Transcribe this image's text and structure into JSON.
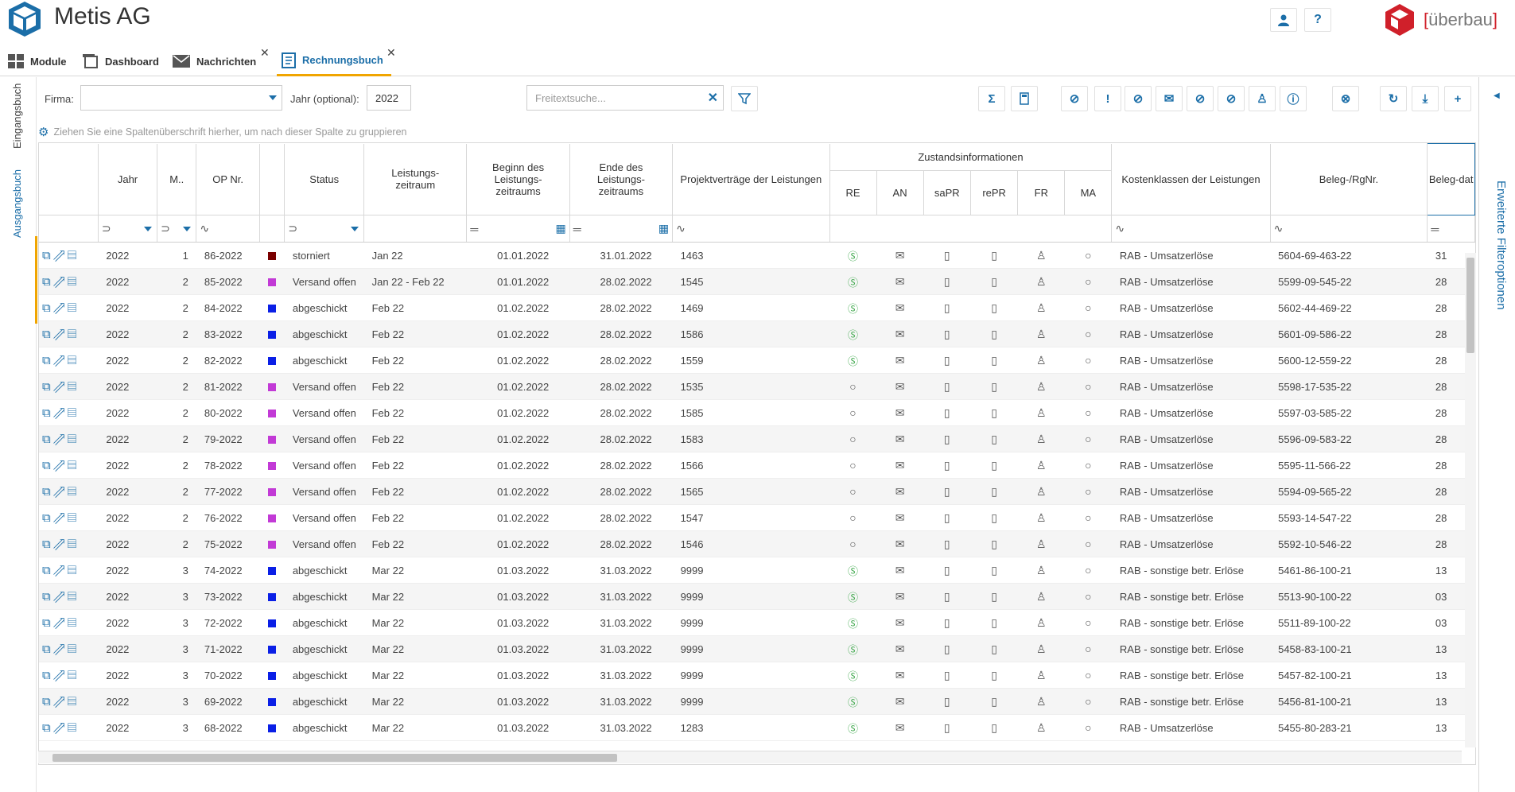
{
  "app": {
    "title": "Metis AG",
    "brand": "überbau"
  },
  "header_buttons": {
    "user": "user-icon",
    "help": "?"
  },
  "tabs": [
    {
      "label": "Module"
    },
    {
      "label": "Dashboard"
    },
    {
      "label": "Nachrichten"
    },
    {
      "label": "Rechnungsbuch"
    }
  ],
  "side_tabs": {
    "eingang": "Eingangsbuch",
    "ausgang": "Ausgangsbuch"
  },
  "filters": {
    "firma_label": "Firma:",
    "firma_value": "",
    "jahr_label": "Jahr (optional):",
    "jahr_value": "2022",
    "search_placeholder": "Freitextsuche..."
  },
  "group_hint": "Ziehen Sie eine Spaltenüberschrift hierher, um nach dieser Spalte zu gruppieren",
  "right_panel": {
    "label": "Erweiterte Filteroptionen"
  },
  "columns": {
    "jahr": "Jahr",
    "monat": "M..",
    "op": "OP Nr.",
    "status": "Status",
    "leistung": "Leistungs-zeitraum",
    "beginn": "Beginn des Leistungs-zeitraums",
    "ende": "Ende des Leistungs-zeitraums",
    "projekt": "Projektverträge der Leistungen",
    "zustand": "Zustandsinformationen",
    "re": "RE",
    "an": "AN",
    "sapr": "saPR",
    "repr": "rePR",
    "fr": "FR",
    "ma": "MA",
    "kosten": "Kostenklassen der Leistungen",
    "beleg": "Beleg-/RgNr.",
    "belegdat": "Beleg-dat"
  },
  "status_colors": {
    "storniert": "#7a0000",
    "Versand offen": "#c23ad6",
    "abgeschickt": "#0a1fe6"
  },
  "rows": [
    {
      "jahr": "2022",
      "m": "1",
      "op": "86-2022",
      "status": "storniert",
      "color": "#7a0000",
      "lz": "Jan 22",
      "beginn": "01.01.2022",
      "ende": "31.01.2022",
      "projekt": "1463",
      "re": "paid",
      "kosten": "RAB - Umsatzerlöse",
      "beleg": "5604-69-463-22",
      "bd": "31"
    },
    {
      "jahr": "2022",
      "m": "2",
      "op": "85-2022",
      "status": "Versand offen",
      "color": "#c23ad6",
      "lz": "Jan 22 - Feb 22",
      "beginn": "01.01.2022",
      "ende": "28.02.2022",
      "projekt": "1545",
      "re": "paid",
      "kosten": "RAB - Umsatzerlöse",
      "beleg": "5599-09-545-22",
      "bd": "28"
    },
    {
      "jahr": "2022",
      "m": "2",
      "op": "84-2022",
      "status": "abgeschickt",
      "color": "#0a1fe6",
      "lz": "Feb 22",
      "beginn": "01.02.2022",
      "ende": "28.02.2022",
      "projekt": "1469",
      "re": "paid",
      "kosten": "RAB - Umsatzerlöse",
      "beleg": "5602-44-469-22",
      "bd": "28"
    },
    {
      "jahr": "2022",
      "m": "2",
      "op": "83-2022",
      "status": "abgeschickt",
      "color": "#0a1fe6",
      "lz": "Feb 22",
      "beginn": "01.02.2022",
      "ende": "28.02.2022",
      "projekt": "1586",
      "re": "paid",
      "kosten": "RAB - Umsatzerlöse",
      "beleg": "5601-09-586-22",
      "bd": "28"
    },
    {
      "jahr": "2022",
      "m": "2",
      "op": "82-2022",
      "status": "abgeschickt",
      "color": "#0a1fe6",
      "lz": "Feb 22",
      "beginn": "01.02.2022",
      "ende": "28.02.2022",
      "projekt": "1559",
      "re": "paid",
      "kosten": "RAB - Umsatzerlöse",
      "beleg": "5600-12-559-22",
      "bd": "28"
    },
    {
      "jahr": "2022",
      "m": "2",
      "op": "81-2022",
      "status": "Versand offen",
      "color": "#c23ad6",
      "lz": "Feb 22",
      "beginn": "01.02.2022",
      "ende": "28.02.2022",
      "projekt": "1535",
      "re": "open",
      "kosten": "RAB - Umsatzerlöse",
      "beleg": "5598-17-535-22",
      "bd": "28"
    },
    {
      "jahr": "2022",
      "m": "2",
      "op": "80-2022",
      "status": "Versand offen",
      "color": "#c23ad6",
      "lz": "Feb 22",
      "beginn": "01.02.2022",
      "ende": "28.02.2022",
      "projekt": "1585",
      "re": "open",
      "kosten": "RAB - Umsatzerlöse",
      "beleg": "5597-03-585-22",
      "bd": "28"
    },
    {
      "jahr": "2022",
      "m": "2",
      "op": "79-2022",
      "status": "Versand offen",
      "color": "#c23ad6",
      "lz": "Feb 22",
      "beginn": "01.02.2022",
      "ende": "28.02.2022",
      "projekt": "1583",
      "re": "open",
      "kosten": "RAB - Umsatzerlöse",
      "beleg": "5596-09-583-22",
      "bd": "28"
    },
    {
      "jahr": "2022",
      "m": "2",
      "op": "78-2022",
      "status": "Versand offen",
      "color": "#c23ad6",
      "lz": "Feb 22",
      "beginn": "01.02.2022",
      "ende": "28.02.2022",
      "projekt": "1566",
      "re": "open",
      "kosten": "RAB - Umsatzerlöse",
      "beleg": "5595-11-566-22",
      "bd": "28"
    },
    {
      "jahr": "2022",
      "m": "2",
      "op": "77-2022",
      "status": "Versand offen",
      "color": "#c23ad6",
      "lz": "Feb 22",
      "beginn": "01.02.2022",
      "ende": "28.02.2022",
      "projekt": "1565",
      "re": "open",
      "kosten": "RAB - Umsatzerlöse",
      "beleg": "5594-09-565-22",
      "bd": "28"
    },
    {
      "jahr": "2022",
      "m": "2",
      "op": "76-2022",
      "status": "Versand offen",
      "color": "#c23ad6",
      "lz": "Feb 22",
      "beginn": "01.02.2022",
      "ende": "28.02.2022",
      "projekt": "1547",
      "re": "open",
      "kosten": "RAB - Umsatzerlöse",
      "beleg": "5593-14-547-22",
      "bd": "28"
    },
    {
      "jahr": "2022",
      "m": "2",
      "op": "75-2022",
      "status": "Versand offen",
      "color": "#c23ad6",
      "lz": "Feb 22",
      "beginn": "01.02.2022",
      "ende": "28.02.2022",
      "projekt": "1546",
      "re": "open",
      "kosten": "RAB - Umsatzerlöse",
      "beleg": "5592-10-546-22",
      "bd": "28"
    },
    {
      "jahr": "2022",
      "m": "3",
      "op": "74-2022",
      "status": "abgeschickt",
      "color": "#0a1fe6",
      "lz": "Mar 22",
      "beginn": "01.03.2022",
      "ende": "31.03.2022",
      "projekt": "9999",
      "re": "paid",
      "kosten": "RAB - sonstige betr. Erlöse",
      "beleg": "5461-86-100-21",
      "bd": "13"
    },
    {
      "jahr": "2022",
      "m": "3",
      "op": "73-2022",
      "status": "abgeschickt",
      "color": "#0a1fe6",
      "lz": "Mar 22",
      "beginn": "01.03.2022",
      "ende": "31.03.2022",
      "projekt": "9999",
      "re": "paid",
      "kosten": "RAB - sonstige betr. Erlöse",
      "beleg": "5513-90-100-22",
      "bd": "03"
    },
    {
      "jahr": "2022",
      "m": "3",
      "op": "72-2022",
      "status": "abgeschickt",
      "color": "#0a1fe6",
      "lz": "Mar 22",
      "beginn": "01.03.2022",
      "ende": "31.03.2022",
      "projekt": "9999",
      "re": "paid",
      "kosten": "RAB - sonstige betr. Erlöse",
      "beleg": "5511-89-100-22",
      "bd": "03"
    },
    {
      "jahr": "2022",
      "m": "3",
      "op": "71-2022",
      "status": "abgeschickt",
      "color": "#0a1fe6",
      "lz": "Mar 22",
      "beginn": "01.03.2022",
      "ende": "31.03.2022",
      "projekt": "9999",
      "re": "paid",
      "kosten": "RAB - sonstige betr. Erlöse",
      "beleg": "5458-83-100-21",
      "bd": "13"
    },
    {
      "jahr": "2022",
      "m": "3",
      "op": "70-2022",
      "status": "abgeschickt",
      "color": "#0a1fe6",
      "lz": "Mar 22",
      "beginn": "01.03.2022",
      "ende": "31.03.2022",
      "projekt": "9999",
      "re": "paid",
      "kosten": "RAB - sonstige betr. Erlöse",
      "beleg": "5457-82-100-21",
      "bd": "13"
    },
    {
      "jahr": "2022",
      "m": "3",
      "op": "69-2022",
      "status": "abgeschickt",
      "color": "#0a1fe6",
      "lz": "Mar 22",
      "beginn": "01.03.2022",
      "ende": "31.03.2022",
      "projekt": "9999",
      "re": "paid",
      "kosten": "RAB - sonstige betr. Erlöse",
      "beleg": "5456-81-100-21",
      "bd": "13"
    },
    {
      "jahr": "2022",
      "m": "3",
      "op": "68-2022",
      "status": "abgeschickt",
      "color": "#0a1fe6",
      "lz": "Mar 22",
      "beginn": "01.03.2022",
      "ende": "31.03.2022",
      "projekt": "1283",
      "re": "paid",
      "kosten": "RAB - Umsatzerlöse",
      "beleg": "5455-80-283-21",
      "bd": "13"
    }
  ]
}
